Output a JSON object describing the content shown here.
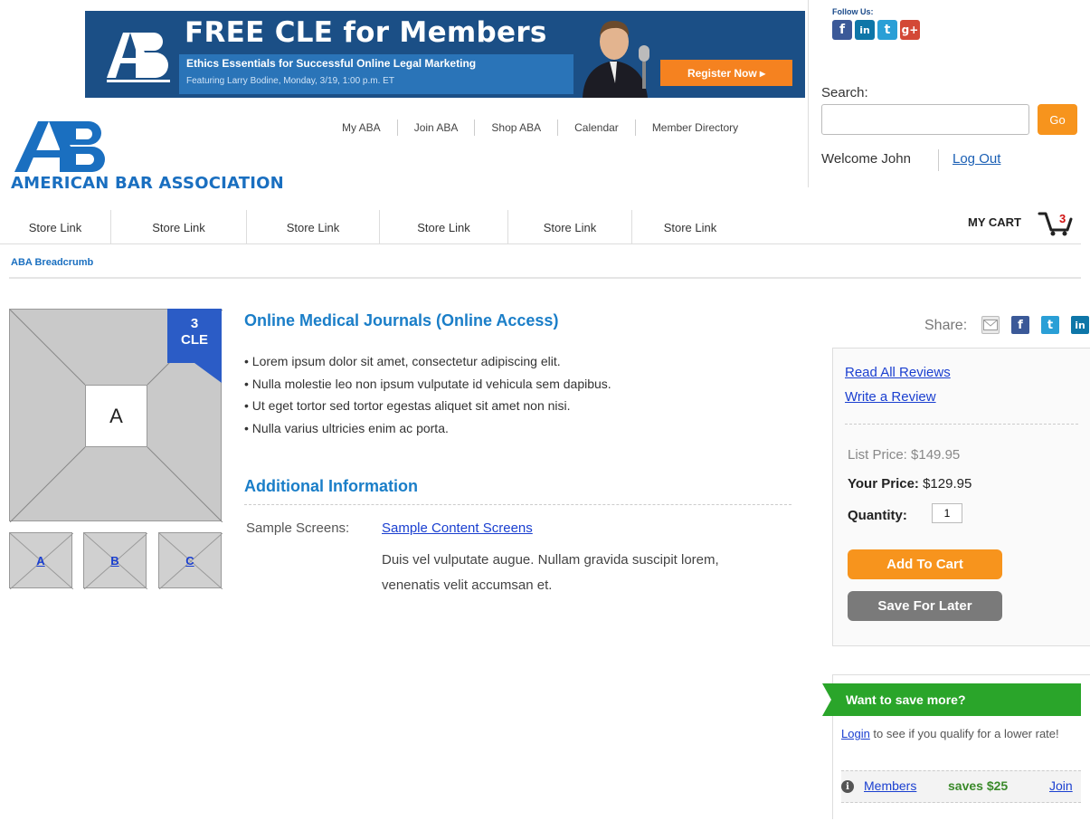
{
  "banner": {
    "headline": "FREE CLE for Members",
    "subline1": "Ethics Essentials for Successful Online Legal Marketing",
    "subline2": "Featuring Larry Bodine, Monday, 3/19, 1:00 p.m. ET",
    "cta": "Register Now ▸"
  },
  "follow": {
    "label": "Follow Us:",
    "icons": [
      "facebook-icon",
      "linkedin-icon",
      "twitter-icon",
      "google-plus-icon"
    ]
  },
  "search": {
    "label": "Search:",
    "value": "",
    "go_label": "Go"
  },
  "account": {
    "welcome": "Welcome John",
    "logout": "Log Out"
  },
  "logo": {
    "name": "AMERICAN BAR ASSOCIATION"
  },
  "topnav": [
    "My ABA",
    "Join ABA",
    "Shop ABA",
    "Calendar",
    "Member Directory"
  ],
  "storenav": [
    "Store Link",
    "Store Link",
    "Store Link",
    "Store Link",
    "Store Link",
    "Store Link"
  ],
  "cart": {
    "label": "MY CART",
    "count": "3"
  },
  "breadcrumb": "ABA Breadcrumb",
  "product": {
    "image_label": "A",
    "cle_number": "3",
    "cle_label": "CLE",
    "thumbs": [
      "A",
      "B",
      "C"
    ],
    "title": "Online Medical Journals (Online Access)",
    "bullets": [
      "• Lorem ipsum dolor sit amet, consectetur adipiscing elit.",
      "• Nulla molestie leo non ipsum vulputate id vehicula sem dapibus.",
      "• Ut eget tortor sed tortor egestas aliquet sit amet non nisi.",
      "• Nulla varius ultricies enim ac porta."
    ],
    "additional_title": "Additional Information",
    "sample_label": "Sample Screens:",
    "sample_link": "Sample Content Screens",
    "sample_desc": "Duis vel vulputate augue. Nullam gravida suscipit lorem, venenatis velit accumsan et."
  },
  "share": {
    "label": "Share:",
    "icons": [
      "email-icon",
      "facebook-icon",
      "twitter-icon",
      "linkedin-icon"
    ]
  },
  "buybox": {
    "read_reviews": "Read All Reviews",
    "write_review": "Write a Review",
    "list_price_label": "List Price:",
    "list_price": "$149.95",
    "your_price_label": "Your Price:",
    "your_price": "$129.95",
    "qty_label": "Quantity:",
    "qty_value": "1",
    "add_to_cart": "Add To Cart",
    "save_later": "Save For Later"
  },
  "promo": {
    "title": "Want to save more?",
    "login_link": "Login",
    "text": " to see if you qualify for a lower rate!",
    "members_link": "Members",
    "saves": "saves $25",
    "join": "Join"
  },
  "colors": {
    "brand_blue": "#1a6fc0",
    "banner_blue": "#1b4f86",
    "accent_orange": "#f7941d",
    "promo_green": "#2aa52a"
  }
}
